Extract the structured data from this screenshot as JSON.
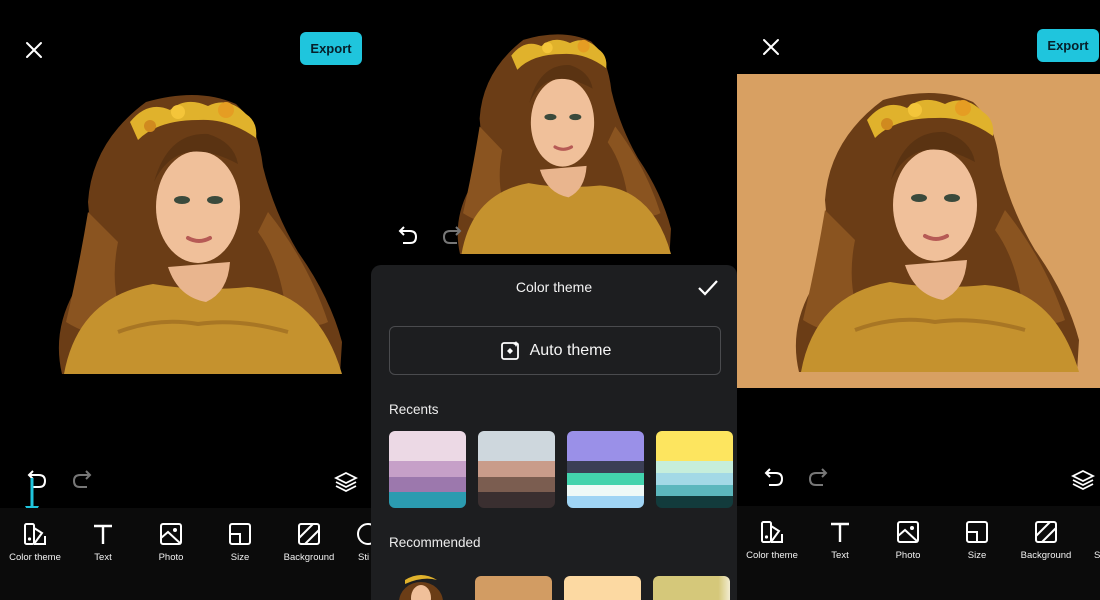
{
  "app": {
    "export_label": "Export",
    "tools": [
      {
        "label": "Color theme",
        "icon": "color-theme-icon"
      },
      {
        "label": "Text",
        "icon": "text-icon"
      },
      {
        "label": "Photo",
        "icon": "photo-icon"
      },
      {
        "label": "Size",
        "icon": "size-icon"
      },
      {
        "label": "Background",
        "icon": "background-icon"
      },
      {
        "label": "Sti",
        "icon": "sticker-icon"
      }
    ],
    "tools_right": [
      {
        "label": "Color theme"
      },
      {
        "label": "Text"
      },
      {
        "label": "Photo"
      },
      {
        "label": "Size"
      },
      {
        "label": "Background"
      },
      {
        "label": "S"
      }
    ]
  },
  "sheet": {
    "title": "Color theme",
    "auto_theme_label": "Auto theme",
    "recents_label": "Recents",
    "recommended_label": "Recommended",
    "recents": [
      {
        "top": "#ecd9e5",
        "stripes": [
          "#c6a0c8",
          "#9c78ad",
          "#2b9bb0"
        ]
      },
      {
        "top": "#ced7dd",
        "stripes": [
          "#c99c8a",
          "#7b5d50",
          "#3a2f30"
        ]
      },
      {
        "top": "#9a90e8",
        "stripes": [
          "#3b3f55",
          "#43d3ad",
          "#eef9f7",
          "#9fd4f4"
        ]
      },
      {
        "top": "#fde55f",
        "stripes": [
          "#c6eedb",
          "#a3d9e6",
          "#5cb7bd",
          "#123b3c"
        ]
      }
    ],
    "recommended": [
      {
        "color": "#d29c63"
      },
      {
        "color": "#fcd9a2"
      },
      {
        "color": "#d5c87a"
      }
    ]
  },
  "colors": {
    "accent": "#1fc5dd",
    "result_background": "#d8a062"
  }
}
